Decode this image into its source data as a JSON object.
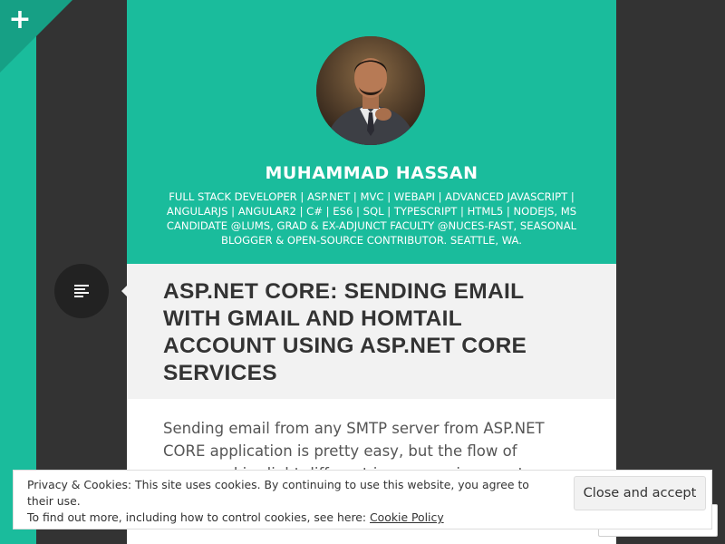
{
  "sidebar_toggle": {
    "icon": "plus-icon",
    "symbol": "+"
  },
  "site": {
    "title": "MUHAMMAD HASSAN",
    "description": "FULL STACK DEVELOPER | ASP.NET | MVC | WEBAPI | ADVANCED JAVASCRIPT | ANGULARJS | ANGULAR2 | C# | ES6 | SQL | TYPESCRIPT | HTML5 | NODEJS, MS CANDIDATE @LUMS, GRAD & EX-ADJUNCT FACULTY @NUCES-FAST, SEASONAL BLOGGER & OPEN-SOURCE CONTRIBUTOR. SEATTLE, WA.",
    "avatar_icon": "avatar-photo"
  },
  "post": {
    "format_icon": "standard-format-icon",
    "title": "ASP.NET CORE: SENDING EMAIL WITH GMAIL AND HOMTAIL ACCOUNT USING ASP.NET CORE SERVICES",
    "excerpt": "Sending email from any SMTP server from ASP.NET CORE application is pretty easy, but the flow of command is slight different in core environment. implicit SSL or explicit SSL (TLS) connection, and you"
  },
  "cookie_banner": {
    "line1": "Privacy & Cookies: This site uses cookies. By continuing to use this website, you agree to their use.",
    "line2_prefix": "To find out more, including how to control cookies, see here: ",
    "link_label": "Cookie Policy",
    "button_label": "Close and accept"
  },
  "colors": {
    "accent": "#1abc9c",
    "accent_dark": "#16a085",
    "background": "#333333",
    "title_band": "#f2f2f2"
  }
}
